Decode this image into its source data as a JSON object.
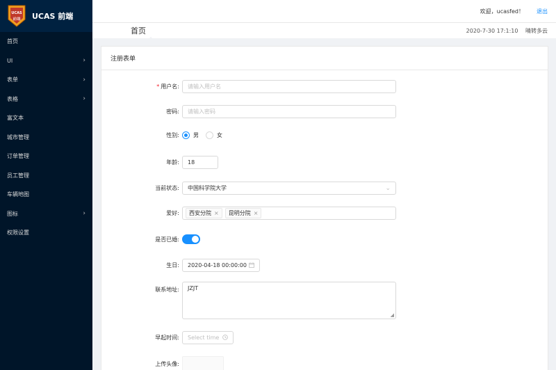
{
  "app": {
    "logo_badge_text_top": "UCAS",
    "logo_badge_text_bottom": "前端",
    "title": "UCAS 前端"
  },
  "sidebar": {
    "items": [
      {
        "label": "首页",
        "has_submenu": false
      },
      {
        "label": "UI",
        "has_submenu": true
      },
      {
        "label": "表单",
        "has_submenu": true
      },
      {
        "label": "表格",
        "has_submenu": true
      },
      {
        "label": "富文本",
        "has_submenu": false
      },
      {
        "label": "城市管理",
        "has_submenu": false
      },
      {
        "label": "订单管理",
        "has_submenu": false
      },
      {
        "label": "员工管理",
        "has_submenu": false
      },
      {
        "label": "车辆地图",
        "has_submenu": false
      },
      {
        "label": "图标",
        "has_submenu": true
      },
      {
        "label": "权限设置",
        "has_submenu": false
      }
    ]
  },
  "header": {
    "welcome": "欢迎，ucasfed！",
    "logout": "退出"
  },
  "titlebar": {
    "page_title": "首页",
    "datetime": "2020-7-30 17:1:10",
    "weather": "晴转多云"
  },
  "form": {
    "card_title": "注册表单",
    "username": {
      "label": "用户名:",
      "placeholder": "请输入用户名",
      "required": true
    },
    "password": {
      "label": "密码:",
      "placeholder": "请输入密码"
    },
    "gender": {
      "label": "性别:",
      "options": [
        "男",
        "女"
      ],
      "selected": "男"
    },
    "age": {
      "label": "年龄:",
      "value": "18"
    },
    "status": {
      "label": "当前状态:",
      "value": "中国科学院大学"
    },
    "hobbies": {
      "label": "爱好:",
      "tags": [
        "西安分院",
        "昆明分院"
      ]
    },
    "married": {
      "label": "是否已婚:",
      "value": true
    },
    "birthday": {
      "label": "生日:",
      "value": "2020-04-18 00:00:00"
    },
    "address": {
      "label": "联系地址:",
      "value": "JZJT"
    },
    "wake_time": {
      "label": "早起时间:",
      "placeholder": "Select time"
    },
    "avatar": {
      "label": "上传头像:"
    }
  },
  "colors": {
    "sidebar_bg": "#001529",
    "accent": "#1890ff",
    "required": "#f5222d"
  }
}
